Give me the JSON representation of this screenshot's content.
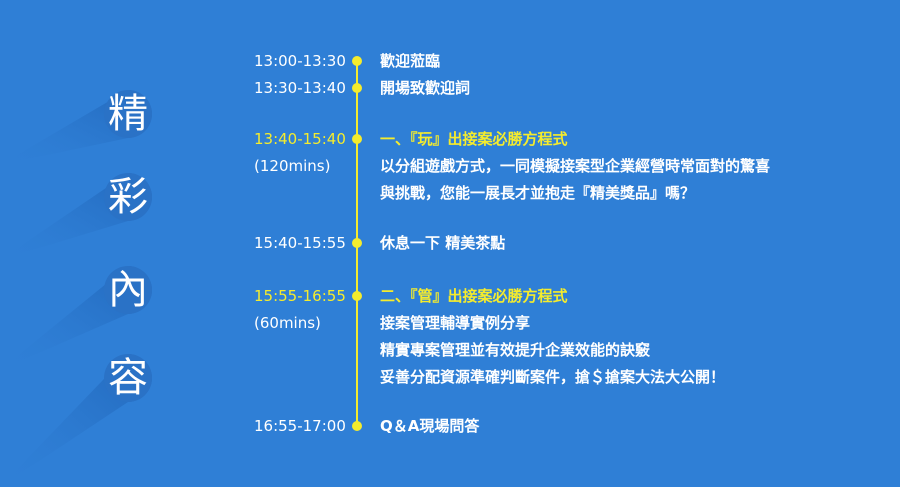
{
  "colors": {
    "background": "#2f7fd6",
    "accent": "#f5ec2d",
    "text": "#ffffff"
  },
  "title_chars": [
    "精",
    "彩",
    "內",
    "容"
  ],
  "schedule": [
    {
      "time": "13:00-13:30",
      "lines": [
        "歡迎蒞臨"
      ]
    },
    {
      "time": "13:30-13:40",
      "lines": [
        "開場致歡迎詞"
      ]
    },
    {
      "time": "13:40-15:40",
      "duration": "(120mins)",
      "lines": [
        "一、『玩』出接案必勝方程式",
        "以分組遊戲方式，一同模擬接案型企業經營時常面對的驚喜",
        "與挑戰，您能一展長才並抱走『精美獎品』嗎？"
      ]
    },
    {
      "time": "15:40-15:55",
      "lines": [
        "休息一下   精美茶點"
      ]
    },
    {
      "time": "15:55-16:55",
      "duration": "(60mins)",
      "lines": [
        "二、『管』出接案必勝方程式",
        "接案管理輔導實例分享",
        "精實專案管理並有效提升企業效能的訣竅",
        "妥善分配資源準確判斷案件，搶＄搶案大法大公開！"
      ]
    },
    {
      "time": "16:55-17:00",
      "lines": [
        "Q＆A現場問答"
      ]
    }
  ]
}
